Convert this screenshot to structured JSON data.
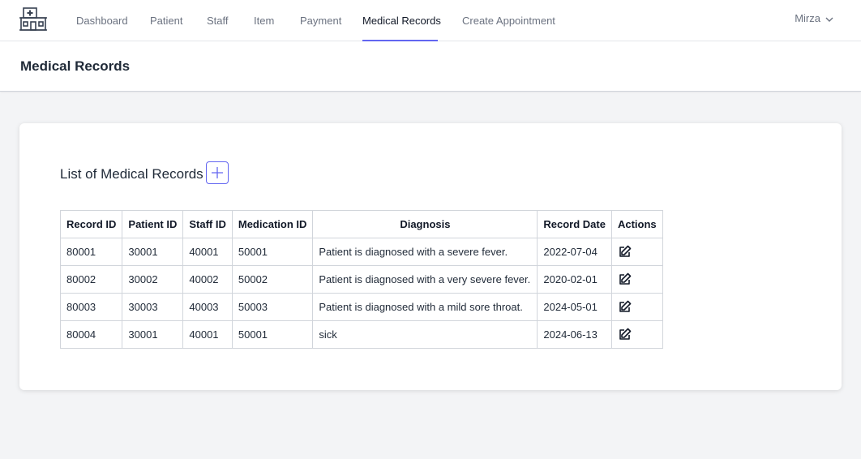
{
  "nav": {
    "items": [
      {
        "label": "Dashboard",
        "active": false
      },
      {
        "label": "Patient",
        "active": false
      },
      {
        "label": "Staff",
        "active": false
      },
      {
        "label": "Item",
        "active": false
      },
      {
        "label": "Payment",
        "active": false
      },
      {
        "label": "Medical Records",
        "active": true
      },
      {
        "label": "Create Appointment",
        "active": false
      }
    ],
    "user_name": "Mirza",
    "logo_icon": "hospital-icon",
    "accent_color": "#6366f1"
  },
  "header": {
    "title": "Medical Records"
  },
  "main": {
    "list_title": "List of Medical Records",
    "add_icon": "plus-icon",
    "table": {
      "columns": [
        "Record ID",
        "Patient ID",
        "Staff ID",
        "Medication ID",
        "Diagnosis",
        "Record Date",
        "Actions"
      ],
      "rows": [
        [
          "80001",
          "30001",
          "40001",
          "50001",
          "Patient is diagnosed with a severe fever.",
          "2022-07-04"
        ],
        [
          "80002",
          "30002",
          "40002",
          "50002",
          "Patient is diagnosed with a very severe fever.",
          "2020-02-01"
        ],
        [
          "80003",
          "30003",
          "40003",
          "50003",
          "Patient is diagnosed with a mild sore throat.",
          "2024-05-01"
        ],
        [
          "80004",
          "30001",
          "40001",
          "50001",
          "sick",
          "2024-06-13"
        ]
      ],
      "action_icon": "edit-icon"
    }
  }
}
